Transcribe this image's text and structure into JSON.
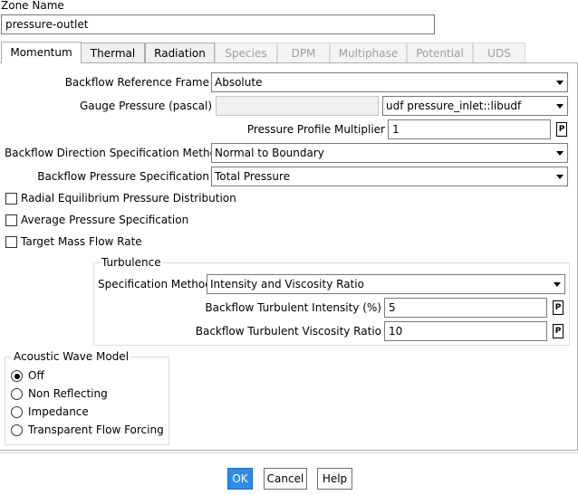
{
  "zone": {
    "label": "Zone Name",
    "value": "pressure-outlet"
  },
  "tabs": [
    {
      "label": "Momentum",
      "active": true,
      "enabled": true
    },
    {
      "label": "Thermal",
      "active": false,
      "enabled": true
    },
    {
      "label": "Radiation",
      "active": false,
      "enabled": true
    },
    {
      "label": "Species",
      "active": false,
      "enabled": false
    },
    {
      "label": "DPM",
      "active": false,
      "enabled": false
    },
    {
      "label": "Multiphase",
      "active": false,
      "enabled": false
    },
    {
      "label": "Potential",
      "active": false,
      "enabled": false
    },
    {
      "label": "UDS",
      "active": false,
      "enabled": false
    }
  ],
  "momentum": {
    "backflow_ref_frame": {
      "label": "Backflow Reference Frame",
      "value": "Absolute"
    },
    "gauge_pressure": {
      "label": "Gauge Pressure (pascal)",
      "value": "",
      "source": "udf pressure_inlet::libudf"
    },
    "pressure_profile_multiplier": {
      "label": "Pressure Profile Multiplier",
      "value": "1"
    },
    "backflow_direction": {
      "label": "Backflow Direction Specification Method",
      "value": "Normal to Boundary"
    },
    "backflow_pressure": {
      "label": "Backflow Pressure Specification",
      "value": "Total Pressure"
    },
    "checkboxes": {
      "radial_equilibrium": {
        "label": "Radial Equilibrium Pressure Distribution",
        "checked": false
      },
      "average_pressure": {
        "label": "Average Pressure Specification",
        "checked": false
      },
      "target_mass_flow": {
        "label": "Target Mass Flow Rate",
        "checked": false
      }
    },
    "turbulence": {
      "title": "Turbulence",
      "method": {
        "label": "Specification Method",
        "value": "Intensity and Viscosity Ratio"
      },
      "intensity": {
        "label": "Backflow Turbulent Intensity (%)",
        "value": "5"
      },
      "viscosity_ratio": {
        "label": "Backflow Turbulent Viscosity Ratio",
        "value": "10"
      }
    },
    "acoustic": {
      "title": "Acoustic Wave Model",
      "options": [
        "Off",
        "Non Reflecting",
        "Impedance",
        "Transparent Flow Forcing"
      ],
      "selected": "Off"
    },
    "p_label": "P"
  },
  "buttons": {
    "ok": "OK",
    "cancel": "Cancel",
    "help": "Help"
  },
  "colors": {
    "primary_button": "#2f8be6"
  }
}
